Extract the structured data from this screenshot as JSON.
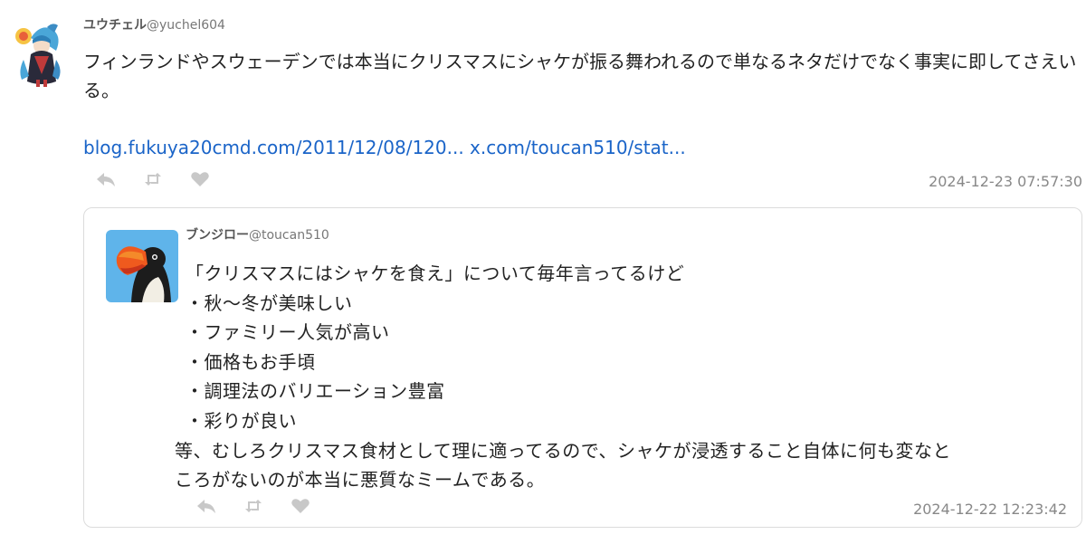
{
  "post": {
    "author_name": "ユウチェル",
    "author_handle": "@yuchel604",
    "text": "フィンランドやスウェーデンでは本当にクリスマスにシャケが振る舞われるので単なるネタだけでなく事実に即してさえいる。",
    "links": [
      "blog.fukuya20cmd.com/2011/12/08/120...",
      "x.com/toucan510/stat..."
    ],
    "timestamp": "2024-12-23 07:57:30",
    "actions": [
      "reply-icon",
      "retweet-icon",
      "like-icon"
    ]
  },
  "quote": {
    "author_name": "ブンジロー",
    "author_handle": "@toucan510",
    "lines": [
      "「クリスマスにはシャケを食え」について毎年言ってるけど",
      "・秋〜冬が美味しい",
      "・ファミリー人気が高い",
      "・価格もお手頃",
      "・調理法のバリエーション豊富",
      "・彩りが良い",
      "等、むしろクリスマス食材として理に適ってるので、シャケが浸透すること自体に何も変なと",
      "ころがないのが本当に悪質なミームである。"
    ],
    "timestamp": "2024-12-22 12:23:42",
    "actions": [
      "reply-icon",
      "retweet-icon",
      "like-icon"
    ]
  },
  "colors": {
    "link": "#1a64c8",
    "icon": "#c8c8c8",
    "timestamp": "#888888",
    "border": "#dcdcdc"
  }
}
